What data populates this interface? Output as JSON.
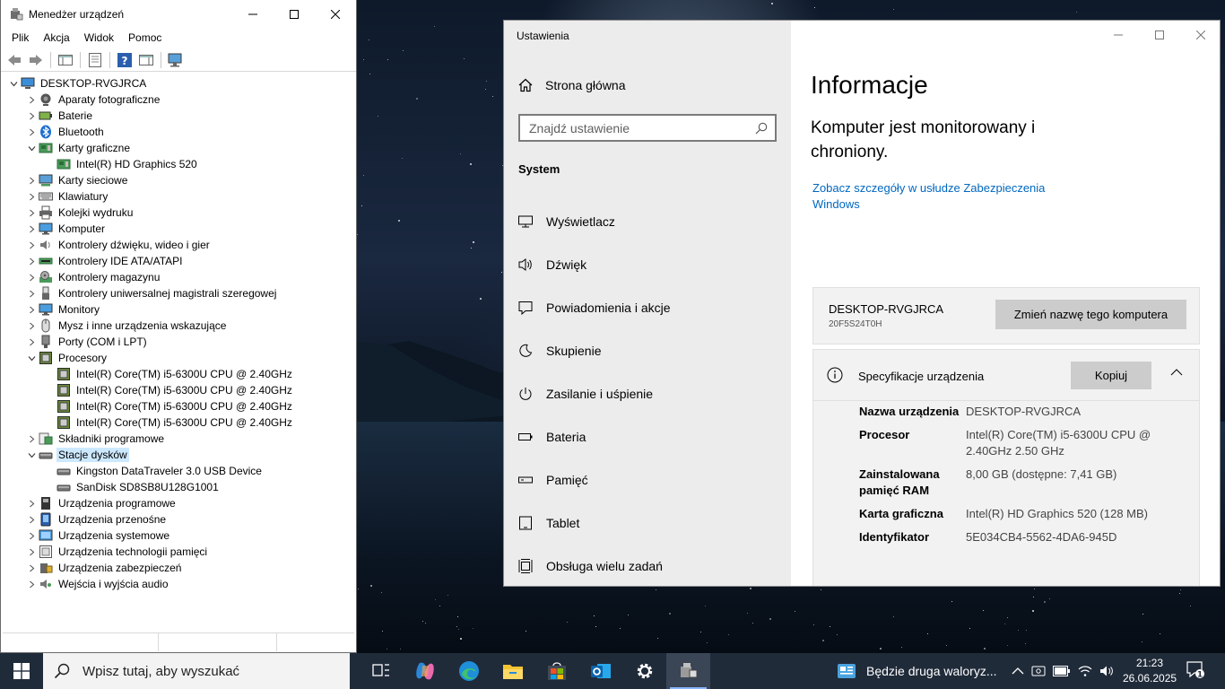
{
  "device_manager": {
    "title": "Menedżer urządzeń",
    "menu": [
      "Plik",
      "Akcja",
      "Widok",
      "Pomoc"
    ],
    "tree": [
      {
        "label": "DESKTOP-RVGJRCA",
        "level": 0,
        "state": "expanded",
        "icon": "computer-icon"
      },
      {
        "label": "Aparaty fotograficzne",
        "level": 1,
        "state": "collapsed",
        "icon": "camera-icon"
      },
      {
        "label": "Baterie",
        "level": 1,
        "state": "collapsed",
        "icon": "battery-icon"
      },
      {
        "label": "Bluetooth",
        "level": 1,
        "state": "collapsed",
        "icon": "bluetooth-icon"
      },
      {
        "label": "Karty graficzne",
        "level": 1,
        "state": "expanded",
        "icon": "display-adapter-icon"
      },
      {
        "label": "Intel(R) HD Graphics 520",
        "level": 2,
        "state": "leaf",
        "icon": "display-adapter-icon"
      },
      {
        "label": "Karty sieciowe",
        "level": 1,
        "state": "collapsed",
        "icon": "network-icon"
      },
      {
        "label": "Klawiatury",
        "level": 1,
        "state": "collapsed",
        "icon": "keyboard-icon"
      },
      {
        "label": "Kolejki wydruku",
        "level": 1,
        "state": "collapsed",
        "icon": "printer-icon"
      },
      {
        "label": "Komputer",
        "level": 1,
        "state": "collapsed",
        "icon": "monitor-icon"
      },
      {
        "label": "Kontrolery dźwięku, wideo i gier",
        "level": 1,
        "state": "collapsed",
        "icon": "speaker-icon"
      },
      {
        "label": "Kontrolery IDE ATA/ATAPI",
        "level": 1,
        "state": "collapsed",
        "icon": "ide-icon"
      },
      {
        "label": "Kontrolery magazynu",
        "level": 1,
        "state": "collapsed",
        "icon": "storage-controller-icon"
      },
      {
        "label": "Kontrolery uniwersalnej magistrali szeregowej",
        "level": 1,
        "state": "collapsed",
        "icon": "usb-icon"
      },
      {
        "label": "Monitory",
        "level": 1,
        "state": "collapsed",
        "icon": "monitor-icon"
      },
      {
        "label": "Mysz i inne urządzenia wskazujące",
        "level": 1,
        "state": "collapsed",
        "icon": "mouse-icon"
      },
      {
        "label": "Porty (COM i LPT)",
        "level": 1,
        "state": "collapsed",
        "icon": "port-icon"
      },
      {
        "label": "Procesory",
        "level": 1,
        "state": "expanded",
        "icon": "cpu-icon"
      },
      {
        "label": "Intel(R) Core(TM) i5-6300U CPU @ 2.40GHz",
        "level": 2,
        "state": "leaf",
        "icon": "cpu-icon"
      },
      {
        "label": "Intel(R) Core(TM) i5-6300U CPU @ 2.40GHz",
        "level": 2,
        "state": "leaf",
        "icon": "cpu-icon"
      },
      {
        "label": "Intel(R) Core(TM) i5-6300U CPU @ 2.40GHz",
        "level": 2,
        "state": "leaf",
        "icon": "cpu-icon"
      },
      {
        "label": "Intel(R) Core(TM) i5-6300U CPU @ 2.40GHz",
        "level": 2,
        "state": "leaf",
        "icon": "cpu-icon"
      },
      {
        "label": "Składniki programowe",
        "level": 1,
        "state": "collapsed",
        "icon": "software-component-icon"
      },
      {
        "label": "Stacje dysków",
        "level": 1,
        "state": "expanded",
        "icon": "disk-drive-icon",
        "selected": true
      },
      {
        "label": "Kingston DataTraveler 3.0 USB Device",
        "level": 2,
        "state": "leaf",
        "icon": "disk-drive-icon"
      },
      {
        "label": "SanDisk SD8SB8U128G1001",
        "level": 2,
        "state": "leaf",
        "icon": "disk-drive-icon"
      },
      {
        "label": "Urządzenia programowe",
        "level": 1,
        "state": "collapsed",
        "icon": "software-device-icon"
      },
      {
        "label": "Urządzenia przenośne",
        "level": 1,
        "state": "collapsed",
        "icon": "portable-device-icon"
      },
      {
        "label": "Urządzenia systemowe",
        "level": 1,
        "state": "collapsed",
        "icon": "system-device-icon"
      },
      {
        "label": "Urządzenia technologii pamięci",
        "level": 1,
        "state": "collapsed",
        "icon": "memory-tech-icon"
      },
      {
        "label": "Urządzenia zabezpieczeń",
        "level": 1,
        "state": "collapsed",
        "icon": "security-device-icon"
      },
      {
        "label": "Wejścia i wyjścia audio",
        "level": 1,
        "state": "collapsed",
        "icon": "audio-io-icon"
      }
    ]
  },
  "settings": {
    "app_title": "Ustawienia",
    "home_label": "Strona główna",
    "search_placeholder": "Znajdź ustawienie",
    "section": "System",
    "nav": [
      {
        "label": "Wyświetlacz",
        "icon": "display-icon"
      },
      {
        "label": "Dźwięk",
        "icon": "sound-icon"
      },
      {
        "label": "Powiadomienia i akcje",
        "icon": "notification-icon"
      },
      {
        "label": "Skupienie",
        "icon": "focus-moon-icon"
      },
      {
        "label": "Zasilanie i uśpienie",
        "icon": "power-icon"
      },
      {
        "label": "Bateria",
        "icon": "battery-icon"
      },
      {
        "label": "Pamięć",
        "icon": "storage-icon"
      },
      {
        "label": "Tablet",
        "icon": "tablet-icon"
      },
      {
        "label": "Obsługa wielu zadań",
        "icon": "multitasking-icon"
      }
    ],
    "page_title": "Informacje",
    "protection_status": "Komputer jest monitorowany i chroniony.",
    "security_link": "Zobacz szczegóły w usłudze Zabezpieczenia Windows",
    "pc_name": "DESKTOP-RVGJRCA",
    "pc_model": "20F5S24T0H",
    "rename_button": "Zmień nazwę tego komputera",
    "specs_header": "Specyfikacje urządzenia",
    "copy_button": "Kopiuj",
    "specs": [
      {
        "key": "Nazwa urządzenia",
        "value": "DESKTOP-RVGJRCA"
      },
      {
        "key": "Procesor",
        "value": "Intel(R) Core(TM) i5-6300U CPU @ 2.40GHz 2.50 GHz"
      },
      {
        "key": "Zainstalowana pamięć RAM",
        "value": "8,00 GB (dostępne: 7,41 GB)"
      },
      {
        "key": "Karta graficzna",
        "value": "Intel(R) HD Graphics 520 (128 MB)"
      },
      {
        "key": "Identyfikator",
        "value": "5E034CB4-5562-4DA6-945D"
      }
    ]
  },
  "taskbar": {
    "search_placeholder": "Wpisz tutaj, aby wyszukać",
    "news_text": "Będzie druga waloryz...",
    "time": "21:23",
    "date": "26.06.2025",
    "notification_count": "1",
    "apps": [
      "task-view-icon",
      "copilot-icon",
      "edge-icon",
      "file-explorer-icon",
      "store-icon",
      "outlook-icon",
      "settings-gear-icon",
      "device-manager-icon"
    ]
  },
  "colors": {
    "accent_link": "#0067c0",
    "selection": "#cce8ff",
    "taskbar": "#202b3a",
    "settings_sidebar": "#ececec"
  }
}
